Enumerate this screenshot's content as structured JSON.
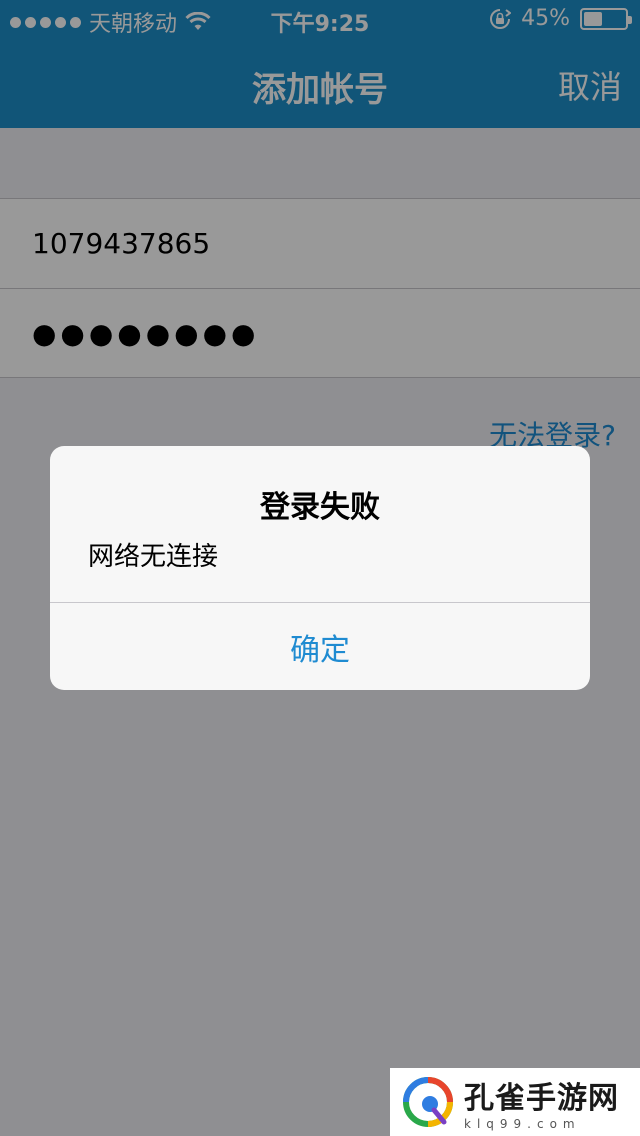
{
  "status_bar": {
    "carrier": "天朝移动",
    "time": "下午9:25",
    "battery_text": "45%",
    "battery_level": 45
  },
  "nav": {
    "title": "添加帐号",
    "cancel_label": "取消"
  },
  "form": {
    "account_value": "1079437865",
    "password_value": "●●●●●●●●"
  },
  "links": {
    "cant_login": "无法登录?"
  },
  "alert": {
    "title": "登录失败",
    "message": "网络无连接",
    "confirm_label": "确定"
  },
  "watermark": {
    "name": "孔雀手游网",
    "url": "klq99.com"
  },
  "colors": {
    "nav_blue": "#1d8ec8",
    "link_blue": "#1f8bd1",
    "overlay": "rgba(0,0,0,0.40)"
  },
  "icons": [
    "signal-dots-icon",
    "wifi-icon",
    "rotation-lock-icon",
    "battery-icon",
    "peacock-logo-icon"
  ]
}
